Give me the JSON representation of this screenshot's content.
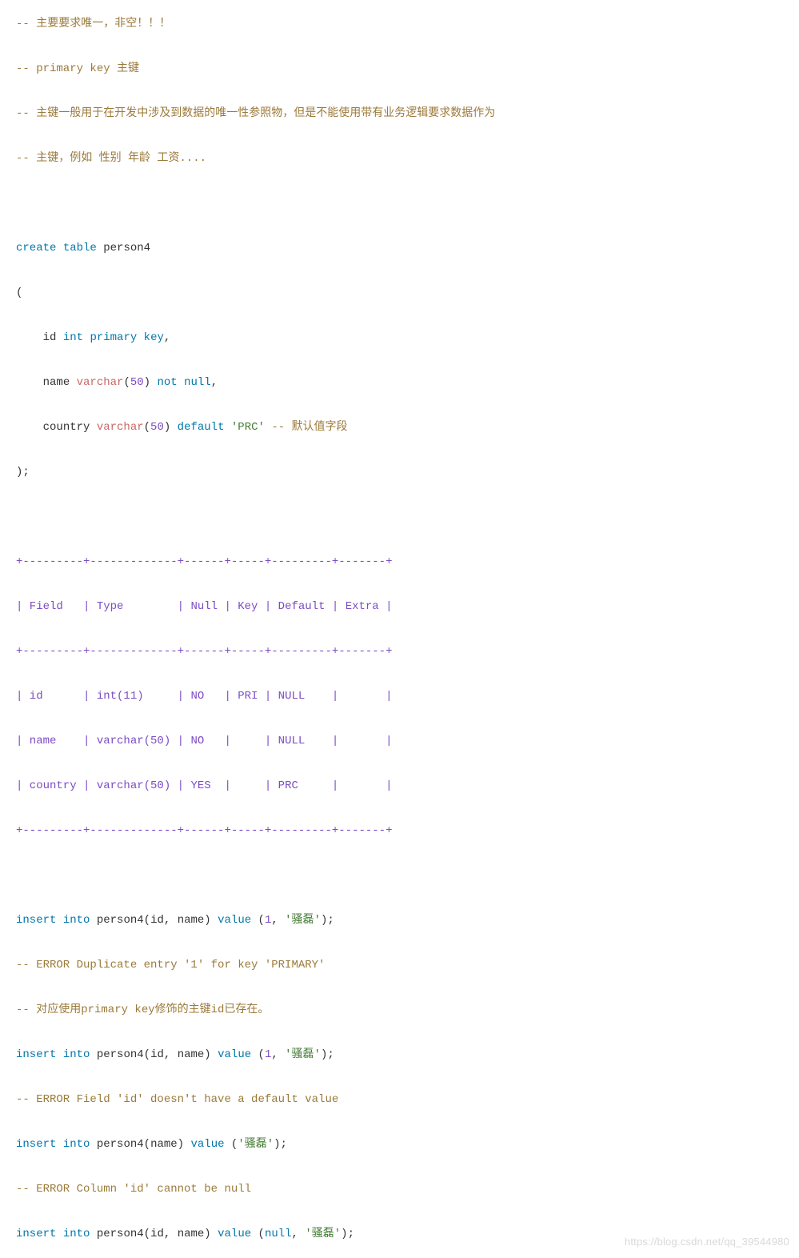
{
  "code": {
    "comment1": "-- 主要要求唯一，非空！！！",
    "comment2": "-- primary key 主键",
    "comment3": "-- 主键一般用于在开发中涉及到数据的唯一性参照物，但是不能使用带有业务逻辑要求数据作为",
    "comment4": "-- 主键，例如 性别 年龄 工资....",
    "kw_create": "create",
    "kw_table": "table",
    "ident_tbl": "person4",
    "lparen": "(",
    "col_id": "id",
    "kw_int": "int",
    "kw_primary": "primary",
    "kw_key": "key",
    "comma": ",",
    "col_name": "name",
    "kw_varchar": "varchar",
    "num_50": "50",
    "kw_not": "not",
    "kw_null": "null",
    "col_country": "country",
    "kw_default": "default",
    "str_prc": "'PRC'",
    "inline_comment": "-- 默认值字段",
    "rparen_semi": ");",
    "tbl_border": "+---------+-------------+------+-----+---------+-------+",
    "th_field": "| Field   ",
    "th_type": "| Type        ",
    "th_null": "| Null ",
    "th_key": "| Key ",
    "th_default": "| Default ",
    "th_extra": "| Extra |",
    "r1_field": "| id      ",
    "r1_type": "| int(11)     ",
    "r1_null": "| NO   ",
    "r1_key": "| PRI ",
    "r1_default": "| NULL    ",
    "r1_extra": "|       |",
    "r2_field": "| name    ",
    "r2_type": "| varchar(50) ",
    "r2_null": "| NO   ",
    "r2_key": "|     ",
    "r2_default": "| NULL    ",
    "r2_extra": "|       |",
    "r3_field": "| country ",
    "r3_type": "| varchar(50) ",
    "r3_null": "| YES  ",
    "r3_key": "|     ",
    "r3_default": "| PRC     ",
    "r3_extra": "|       |",
    "kw_insert": "insert",
    "kw_into": "into",
    "kw_value": "value",
    "num_1": "1",
    "str_name": "'骚磊'",
    "err1": "-- ERROR Duplicate entry '1' for key 'PRIMARY'",
    "err1_cn": "-- 对应使用primary key修饰的主键id已存在。",
    "err2": "-- ERROR Field 'id' doesn't have a default value",
    "err3": "-- ERROR Column 'id' cannot be null"
  },
  "watermark": "https://blog.csdn.net/qq_39544980"
}
